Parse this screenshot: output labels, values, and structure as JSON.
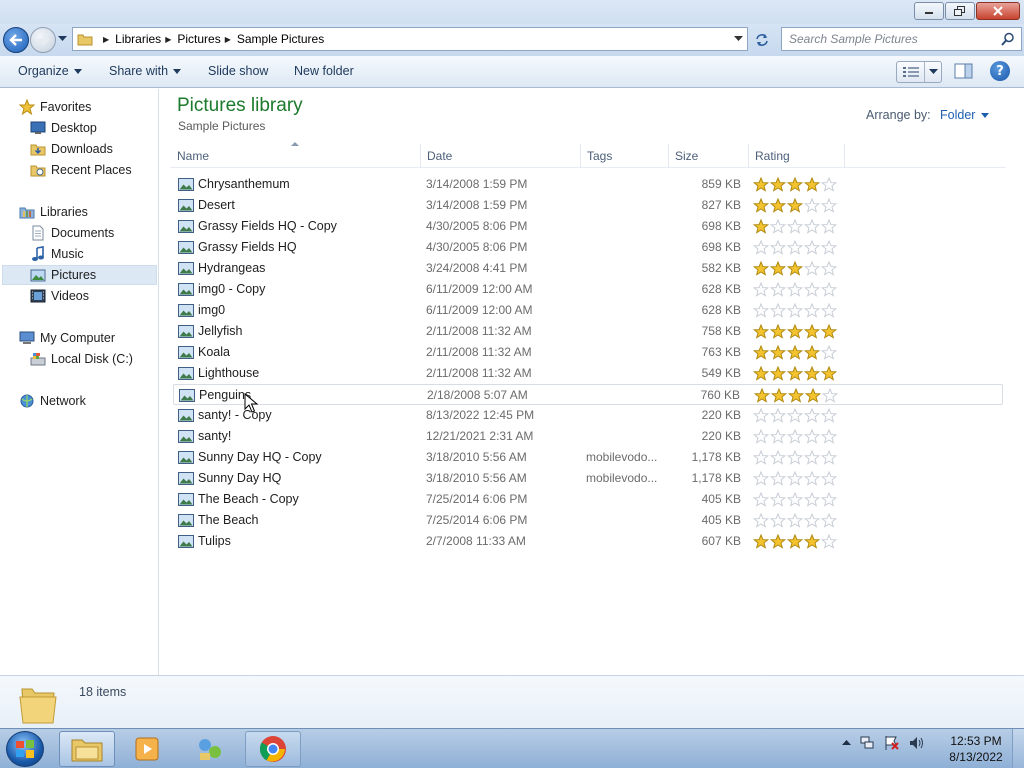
{
  "address": {
    "breadcrumbs": [
      "Libraries",
      "Pictures",
      "Sample Pictures"
    ]
  },
  "search": {
    "placeholder": "Search Sample Pictures"
  },
  "toolbar": {
    "organize": "Organize",
    "share_with": "Share with",
    "slide_show": "Slide show",
    "new_folder": "New folder"
  },
  "nav": {
    "favorites": "Favorites",
    "desktop": "Desktop",
    "downloads": "Downloads",
    "recent_places": "Recent Places",
    "libraries": "Libraries",
    "documents": "Documents",
    "music": "Music",
    "pictures": "Pictures",
    "videos": "Videos",
    "my_computer": "My Computer",
    "local_disk": "Local Disk (C:)",
    "network": "Network"
  },
  "library": {
    "title": "Pictures library",
    "subtitle": "Sample Pictures",
    "arrange_label": "Arrange by:",
    "arrange_value": "Folder"
  },
  "columns": {
    "name": "Name",
    "date": "Date",
    "tags": "Tags",
    "size": "Size",
    "rating": "Rating"
  },
  "files": [
    {
      "name": "Chrysanthemum",
      "date": "3/14/2008 1:59 PM",
      "tags": "",
      "size": "859 KB",
      "rating": 4
    },
    {
      "name": "Desert",
      "date": "3/14/2008 1:59 PM",
      "tags": "",
      "size": "827 KB",
      "rating": 3
    },
    {
      "name": "Grassy Fields HQ - Copy",
      "date": "4/30/2005 8:06 PM",
      "tags": "",
      "size": "698 KB",
      "rating": 1
    },
    {
      "name": "Grassy Fields HQ",
      "date": "4/30/2005 8:06 PM",
      "tags": "",
      "size": "698 KB",
      "rating": 0
    },
    {
      "name": "Hydrangeas",
      "date": "3/24/2008 4:41 PM",
      "tags": "",
      "size": "582 KB",
      "rating": 3
    },
    {
      "name": "img0 - Copy",
      "date": "6/11/2009 12:00 AM",
      "tags": "",
      "size": "628 KB",
      "rating": 0
    },
    {
      "name": "img0",
      "date": "6/11/2009 12:00 AM",
      "tags": "",
      "size": "628 KB",
      "rating": 0
    },
    {
      "name": "Jellyfish",
      "date": "2/11/2008 11:32 AM",
      "tags": "",
      "size": "758 KB",
      "rating": 5
    },
    {
      "name": "Koala",
      "date": "2/11/2008 11:32 AM",
      "tags": "",
      "size": "763 KB",
      "rating": 4
    },
    {
      "name": "Lighthouse",
      "date": "2/11/2008 11:32 AM",
      "tags": "",
      "size": "549 KB",
      "rating": 5
    },
    {
      "name": "Penguins",
      "date": "2/18/2008 5:07 AM",
      "tags": "",
      "size": "760 KB",
      "rating": 4
    },
    {
      "name": "santy! - Copy",
      "date": "8/13/2022 12:45 PM",
      "tags": "",
      "size": "220 KB",
      "rating": 0
    },
    {
      "name": "santy!",
      "date": "12/21/2021 2:31 AM",
      "tags": "",
      "size": "220 KB",
      "rating": 0
    },
    {
      "name": "Sunny Day HQ - Copy",
      "date": "3/18/2010 5:56 AM",
      "tags": "mobilevodo...",
      "size": "1,178 KB",
      "rating": 0
    },
    {
      "name": "Sunny Day HQ",
      "date": "3/18/2010 5:56 AM",
      "tags": "mobilevodo...",
      "size": "1,178 KB",
      "rating": 0
    },
    {
      "name": "The Beach - Copy",
      "date": "7/25/2014 6:06 PM",
      "tags": "",
      "size": "405 KB",
      "rating": 0
    },
    {
      "name": "The Beach",
      "date": "7/25/2014 6:06 PM",
      "tags": "",
      "size": "405 KB",
      "rating": 0
    },
    {
      "name": "Tulips",
      "date": "2/7/2008 11:33 AM",
      "tags": "",
      "size": "607 KB",
      "rating": 4
    }
  ],
  "status": {
    "count": "18 items"
  },
  "clock": {
    "time": "12:53 PM",
    "date": "8/13/2022"
  },
  "colors": {
    "library_title": "#1c7a2d",
    "star_filled": "#f4c430",
    "star_empty": "#c9ced6"
  }
}
